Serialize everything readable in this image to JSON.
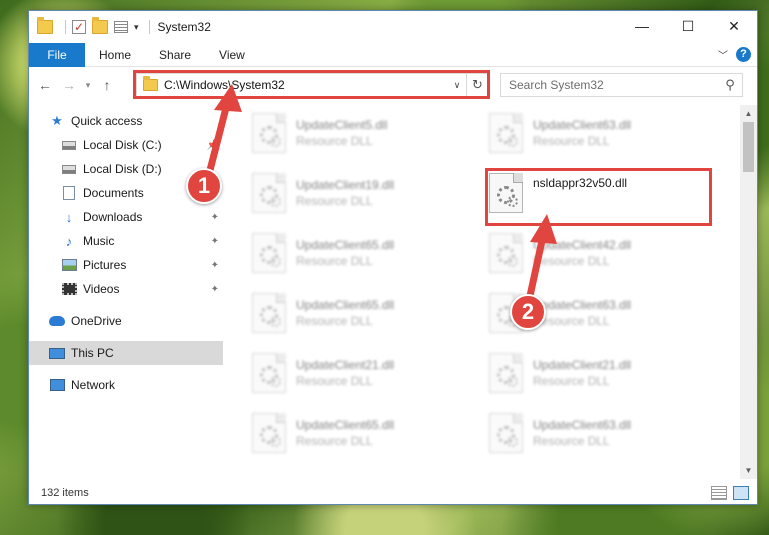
{
  "window": {
    "title": "System32",
    "controls": {
      "minimize": "—",
      "maximize": "☐",
      "close": "✕"
    }
  },
  "ribbon": {
    "file": "File",
    "tabs": [
      "Home",
      "Share",
      "View"
    ],
    "help": "?"
  },
  "nav": {
    "address": "C:\\Windows\\System32",
    "search_placeholder": "Search System32"
  },
  "sidebar": {
    "quick_access": "Quick access",
    "items": [
      {
        "label": "Local Disk (C:)",
        "icon": "drive-icon"
      },
      {
        "label": "Local Disk (D:)",
        "icon": "drive-icon"
      },
      {
        "label": "Documents",
        "icon": "documents-icon"
      },
      {
        "label": "Downloads",
        "icon": "downloads-icon"
      },
      {
        "label": "Music",
        "icon": "music-icon"
      },
      {
        "label": "Pictures",
        "icon": "pictures-icon"
      },
      {
        "label": "Videos",
        "icon": "videos-icon"
      }
    ],
    "onedrive": "OneDrive",
    "this_pc": "This PC",
    "network": "Network"
  },
  "files": [
    {
      "name": "UpdateClient5.dll",
      "type": "Resource DLL"
    },
    {
      "name": "UpdateClient63.dll",
      "type": "Resource DLL"
    },
    {
      "name": "UpdateClient19.dll",
      "type": "Resource DLL"
    },
    {
      "name": "nsldappr32v50.dll",
      "type": ""
    },
    {
      "name": "UpdateClient65.dll",
      "type": "Resource DLL"
    },
    {
      "name": "UpdateClient42.dll",
      "type": "Resource DLL"
    },
    {
      "name": "UpdateClient65.dll",
      "type": "Resource DLL"
    },
    {
      "name": "UpdateClient63.dll",
      "type": "Resource DLL"
    },
    {
      "name": "UpdateClient21.dll",
      "type": "Resource DLL"
    },
    {
      "name": "UpdateClient21.dll",
      "type": "Resource DLL"
    },
    {
      "name": "UpdateClient65.dll",
      "type": "Resource DLL"
    },
    {
      "name": "UpdateClient63.dll",
      "type": "Resource DLL"
    }
  ],
  "status": {
    "item_count": "132 items"
  },
  "annotations": {
    "step1": "1",
    "step2": "2",
    "color": "#e0453f"
  }
}
